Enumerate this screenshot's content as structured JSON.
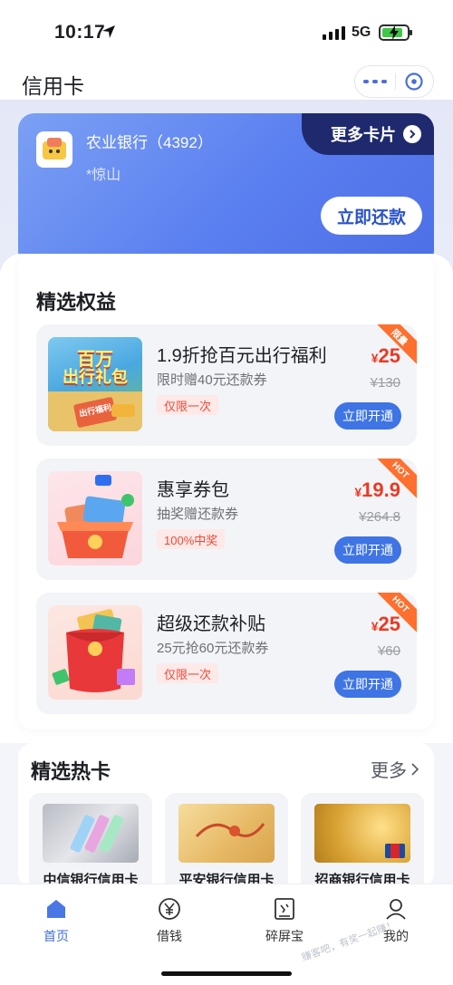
{
  "status": {
    "time": "10:17",
    "network": "5G"
  },
  "nav": {
    "title": "信用卡"
  },
  "card": {
    "bank": "农业银行（4392）",
    "holder": "*惊山",
    "more_cards": "更多卡片",
    "repay_button": "立即还款",
    "gradient": [
      "#7ba0f4",
      "#4d6fe6"
    ]
  },
  "benefits": {
    "title": "精选权益",
    "items": [
      {
        "title": "1.9折抢百元出行福利",
        "subtitle": "限时赠40元还款券",
        "tag": "仅限一次",
        "price": "25",
        "original": "¥130",
        "button": "立即开通",
        "badge": "限量",
        "thumb_text_1": "百万",
        "thumb_text_2": "出行礼包",
        "thumb_text_3": "出行福利"
      },
      {
        "title": "惠享券包",
        "subtitle": "抽奖赠还款券",
        "tag": "100%中奖",
        "price": "19.9",
        "original": "¥264.8",
        "button": "立即开通",
        "badge": "HOT"
      },
      {
        "title": "超级还款补贴",
        "subtitle": "25元抢60元还款券",
        "tag": "仅限一次",
        "price": "25",
        "original": "¥60",
        "button": "立即开通",
        "badge": "HOT"
      }
    ]
  },
  "hot_cards": {
    "title": "精选热卡",
    "more": "更多",
    "items": [
      {
        "name": "中信银行信用卡"
      },
      {
        "name": "平安银行信用卡"
      },
      {
        "name": "招商银行信用卡"
      }
    ]
  },
  "tabbar": {
    "items": [
      {
        "label": "首页",
        "icon": "home-icon"
      },
      {
        "label": "借钱",
        "icon": "yuan-icon"
      },
      {
        "label": "碎屏宝",
        "icon": "broken-screen-icon"
      },
      {
        "label": "我的",
        "icon": "user-icon"
      }
    ]
  },
  "watermark": "赚客吧，有奖一起赚！"
}
